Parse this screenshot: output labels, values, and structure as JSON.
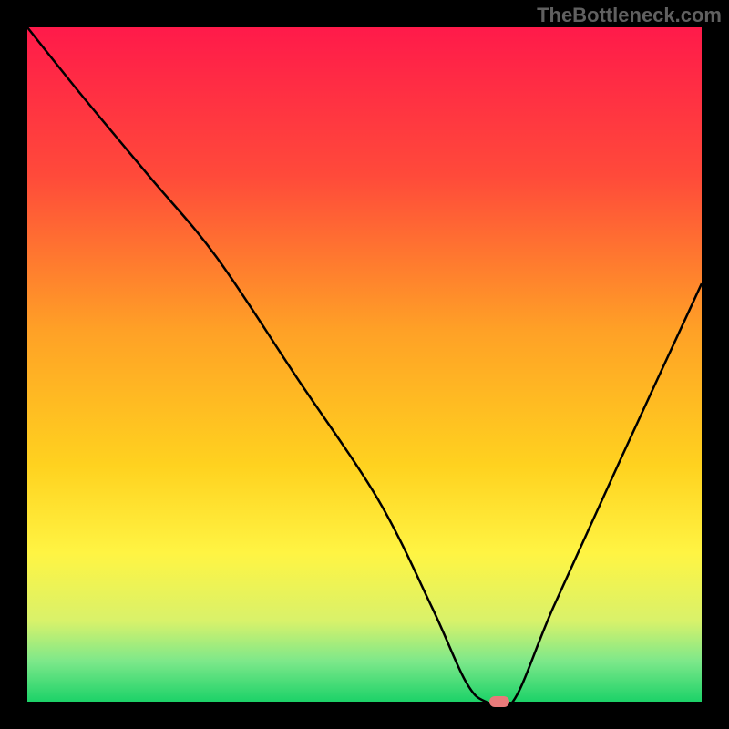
{
  "watermark": "TheBottleneck.com",
  "chart_data": {
    "type": "line",
    "title": "",
    "xlabel": "",
    "ylabel": "",
    "xlim": [
      0,
      100
    ],
    "ylim": [
      0,
      100
    ],
    "gradient_stops": [
      {
        "offset": 0,
        "color": "#ff1a4a"
      },
      {
        "offset": 22,
        "color": "#ff4a3a"
      },
      {
        "offset": 45,
        "color": "#ffa126"
      },
      {
        "offset": 65,
        "color": "#ffd21f"
      },
      {
        "offset": 78,
        "color": "#fff443"
      },
      {
        "offset": 88,
        "color": "#d9f26a"
      },
      {
        "offset": 94,
        "color": "#7de88a"
      },
      {
        "offset": 100,
        "color": "#1cd268"
      }
    ],
    "series": [
      {
        "name": "bottleneck-curve",
        "x": [
          0,
          8,
          18,
          28,
          40,
          52,
          60,
          65,
          68,
          72,
          78,
          88,
          100
        ],
        "y": [
          100,
          90,
          78,
          66,
          48,
          30,
          14,
          3,
          0,
          0,
          14,
          36,
          62
        ]
      }
    ],
    "marker": {
      "x": 70,
      "y": 0,
      "color": "#e87a7a"
    }
  }
}
